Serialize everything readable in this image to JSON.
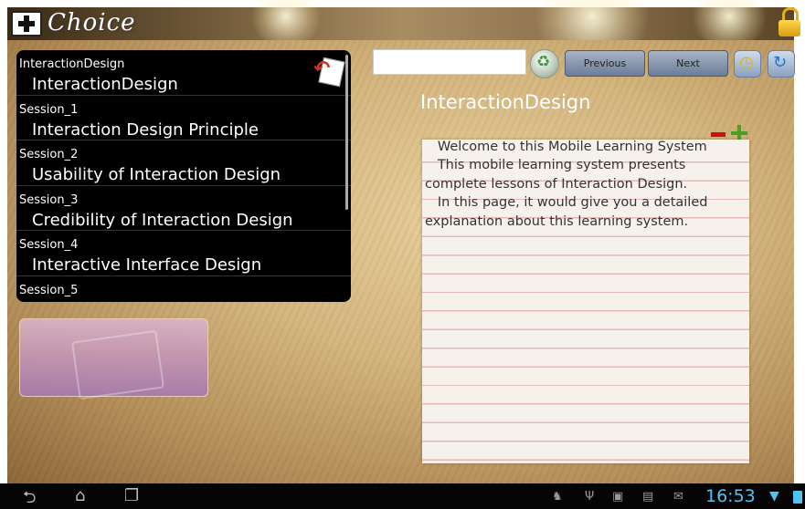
{
  "app": {
    "brand": "Choice"
  },
  "list": {
    "items": [
      {
        "small": "InteractionDesign",
        "big": "InteractionDesign"
      },
      {
        "small": "Session_1",
        "big": "Interaction Design Principle"
      },
      {
        "small": "Session_2",
        "big": "Usability of Interaction Design"
      },
      {
        "small": "Session_3",
        "big": "Credibility of Interaction Design"
      },
      {
        "small": "Session_4",
        "big": "Interactive Interface Design"
      },
      {
        "small": "Session_5",
        "big": ""
      }
    ]
  },
  "toolbar": {
    "search_value": "",
    "previous_label": "Previous",
    "next_label": "Next"
  },
  "content": {
    "title": "InteractionDesign",
    "body": "   Welcome to this Mobile Learning System\n   This mobile learning system presents\ncomplete lessons of Interaction Design.\n   In this page, it would give you a detailed\nexplanation about this learning system."
  },
  "statusbar": {
    "time": "16:53"
  },
  "icons": {
    "top_left": "move-cross-icon",
    "top_right": "lock-icon",
    "list_back": "back-document-icon",
    "clear": "recycle-icon",
    "ic1": "clock-icon",
    "ic2": "refresh-icon",
    "zoom_out": "minus-icon",
    "zoom_in": "plus-icon"
  },
  "colors": {
    "accent": "#4fc3f7",
    "list_bg": "#000000",
    "button": "#8896ae"
  }
}
